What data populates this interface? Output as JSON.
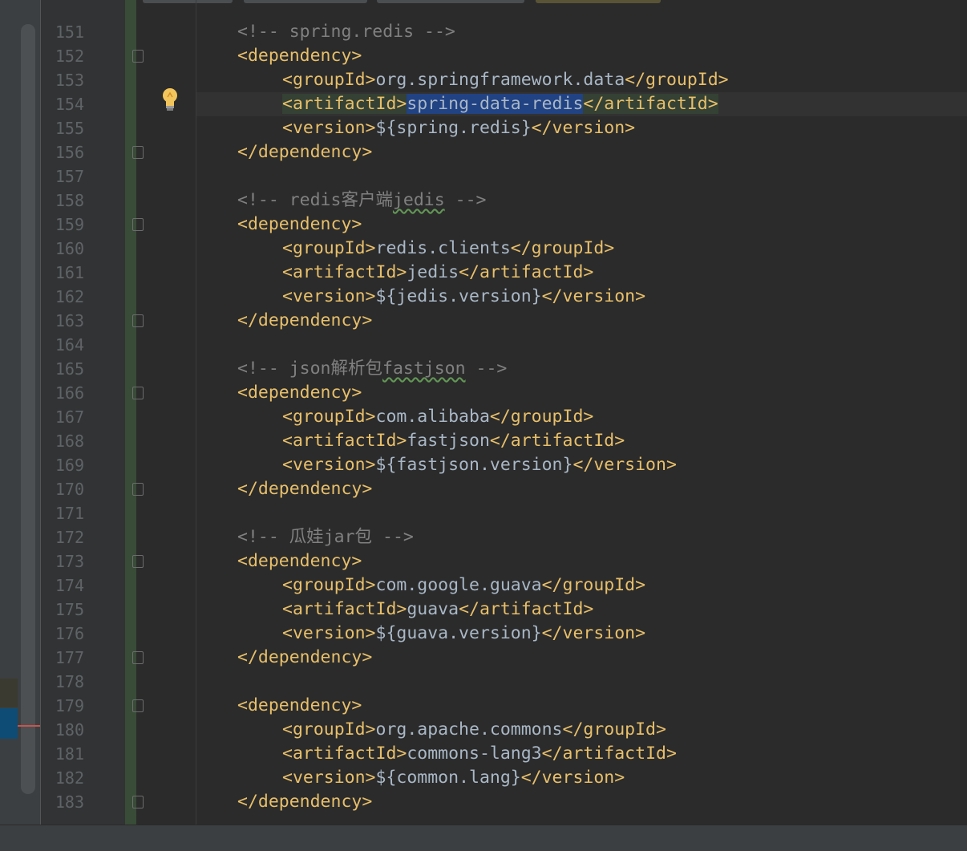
{
  "colors": {
    "background": "#2b2b2b",
    "gutter": "#313335",
    "tag": "#e8bf6a",
    "comment": "#808080",
    "text": "#a9b7c6",
    "selection": "#214283",
    "line_number": "#606366"
  },
  "line_numbers": [
    "151",
    "152",
    "153",
    "154",
    "155",
    "156",
    "157",
    "158",
    "159",
    "160",
    "161",
    "162",
    "163",
    "164",
    "165",
    "166",
    "167",
    "168",
    "169",
    "170",
    "171",
    "172",
    "173",
    "174",
    "175",
    "176",
    "177",
    "178",
    "179",
    "180",
    "181",
    "182",
    "183"
  ],
  "code": {
    "c151": "<!-- spring.redis -->",
    "d_open": "<dependency>",
    "d_close": "</dependency>",
    "g_open": "<groupId>",
    "g_close": "</groupId>",
    "a_open": "<artifactId>",
    "a_close": "</artifactId>",
    "v_open": "<version>",
    "v_close": "</version>",
    "g153": "org.springframework.data",
    "a154": "spring-data-redis",
    "v155": "${spring.redis}",
    "c158_pre": "<!-- redis客户端",
    "c158_word": "jedis",
    "c158_post": " -->",
    "g160": "redis.clients",
    "a161": "jedis",
    "v162": "${jedis.version}",
    "c165_pre": "<!-- json解析包",
    "c165_word": "fastjson",
    "c165_post": " -->",
    "g167": "com.alibaba",
    "a168": "fastjson",
    "v169": "${fastjson.version}",
    "c172": "<!-- 瓜娃jar包 -->",
    "g174": "com.google.guava",
    "a175": "guava",
    "v176": "${guava.version}",
    "g180": "org.apache.commons",
    "a181": "commons-lang3",
    "v182": "${common.lang}"
  },
  "icons": {
    "intention": "lightbulb-icon",
    "fold": "fold-marker-icon"
  }
}
